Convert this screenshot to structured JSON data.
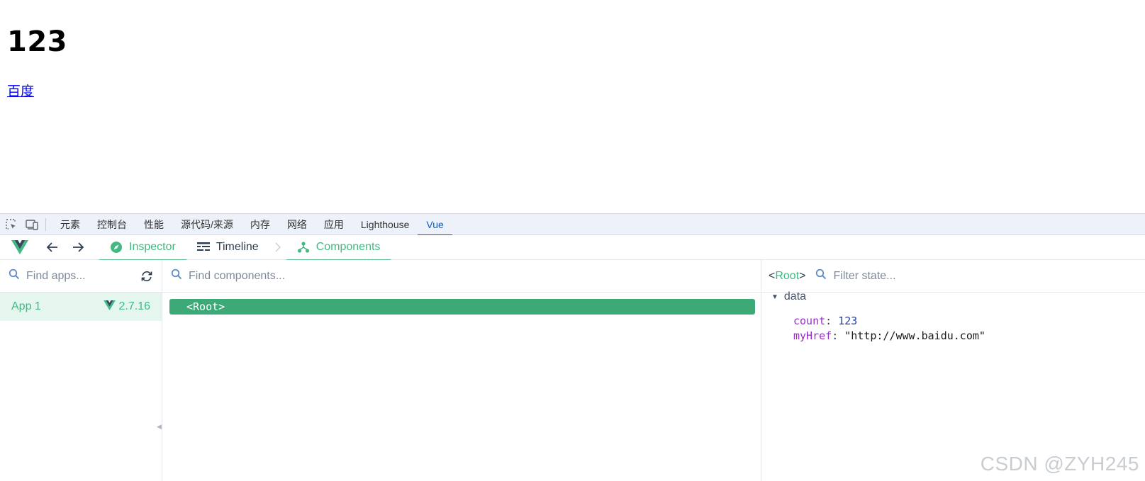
{
  "page": {
    "heading": "123",
    "link_text": "百度"
  },
  "devtools_tabs": [
    {
      "label": "元素"
    },
    {
      "label": "控制台"
    },
    {
      "label": "性能"
    },
    {
      "label": "源代码/来源"
    },
    {
      "label": "内存"
    },
    {
      "label": "网络"
    },
    {
      "label": "应用"
    },
    {
      "label": "Lighthouse"
    },
    {
      "label": "Vue",
      "active": true
    }
  ],
  "vue_toolbar": {
    "inspector_label": "Inspector",
    "timeline_label": "Timeline",
    "components_label": "Components"
  },
  "apps_pane": {
    "search_placeholder": "Find apps...",
    "apps": [
      {
        "name": "App 1",
        "version": "2.7.16"
      }
    ]
  },
  "components_pane": {
    "search_placeholder": "Find components...",
    "root_label": "<Root>"
  },
  "state_pane": {
    "root_tag_open": "<",
    "root_name": "Root",
    "root_tag_close": ">",
    "search_placeholder": "Filter state...",
    "section": "data",
    "props": [
      {
        "key": "count",
        "value": "123",
        "kind": "number"
      },
      {
        "key": "myHref",
        "value": "\"http://www.baidu.com\"",
        "kind": "string"
      }
    ]
  },
  "watermark": "CSDN @ZYH245",
  "colors": {
    "vue_green": "#42b883",
    "root_row_bg": "#3da977",
    "active_tab_blue": "#0b57d0",
    "tab_bar_bg": "#edf2fa",
    "link": "#0000ee"
  }
}
